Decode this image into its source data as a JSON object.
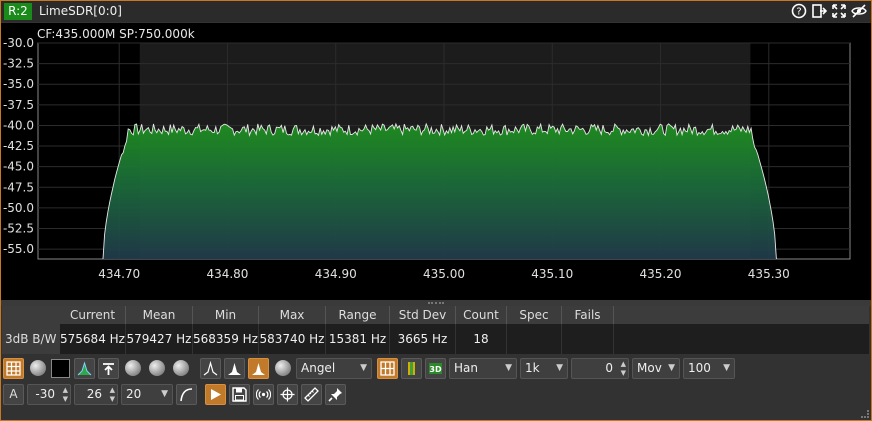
{
  "titlebar": {
    "badge": "R:2",
    "title": "LimeSDR[0:0]",
    "icons": [
      "help-icon",
      "detach-icon",
      "maximize-icon",
      "hide-icon"
    ]
  },
  "spectrum": {
    "info": "CF:435.000M SP:750.000k",
    "y_ticks": [
      "-30.0",
      "-32.5",
      "-35.0",
      "-37.5",
      "-40.0",
      "-42.5",
      "-45.0",
      "-47.5",
      "-50.0",
      "-52.5",
      "-55.0"
    ],
    "x_ticks": [
      "434.70",
      "434.80",
      "434.90",
      "435.00",
      "435.10",
      "435.20",
      "435.30"
    ],
    "ylim": [
      -56.2,
      -30.0
    ],
    "xlim_MHz": [
      434.625,
      435.375
    ],
    "shaded_MHz": [
      434.719,
      435.283
    ],
    "trace_MHz": [
      434.685,
      435.307
    ],
    "plateau_dB": -40.5,
    "colors": {
      "fill_top": "#1f8f1f",
      "fill_bottom": "#203a4a",
      "trace": "#e8e8e8"
    }
  },
  "measurements": {
    "columns": [
      "Current",
      "Mean",
      "Min",
      "Max",
      "Range",
      "Std Dev",
      "Count",
      "Spec",
      "Fails"
    ],
    "rows": [
      {
        "label": "3dB B/W",
        "values": [
          "575684 Hz",
          "579427 Hz",
          "568359 Hz",
          "583740 Hz",
          "15381 Hz",
          "3665 Hz",
          "18",
          "",
          ""
        ]
      }
    ]
  },
  "controls": {
    "palette": "Angel",
    "window": "Han",
    "fft_size": "1k",
    "avg_count": "0",
    "avg_mode": "Mov",
    "update_rate": "100",
    "auto_label": "A",
    "ref_level": "-30",
    "range": "26",
    "ytick_step": "20"
  }
}
